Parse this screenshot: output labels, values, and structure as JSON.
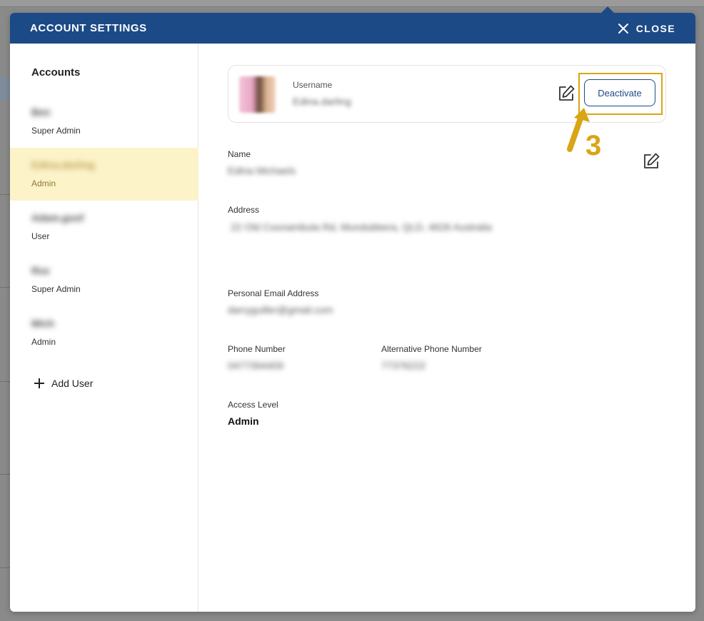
{
  "header": {
    "title": "ACCOUNT SETTINGS",
    "close_label": "CLOSE"
  },
  "sidebar": {
    "heading": "Accounts",
    "accounts": [
      {
        "name": "Ben",
        "role": "Super Admin",
        "selected": false
      },
      {
        "name": "Edina.darling",
        "role": "Admin",
        "selected": true
      },
      {
        "name": "Adam.goof",
        "role": "User",
        "selected": false
      },
      {
        "name": "Roz",
        "role": "Super Admin",
        "selected": false
      },
      {
        "name": "Mich",
        "role": "Admin",
        "selected": false
      }
    ],
    "add_user_label": "Add User"
  },
  "profile": {
    "username_label": "Username",
    "username_value": "Edina.darling",
    "deactivate_label": "Deactivate",
    "annotation_number": "3",
    "name_label": "Name",
    "name_value": "Edina Michaels",
    "address_label": "Address",
    "address_value": "22 Old Coonambula Rd, Mundubbera, QLD, 4626 Australia",
    "email_label": "Personal Email Address",
    "email_value": "darryguiller@gmail.com",
    "phone_label": "Phone Number",
    "phone_value": "0477394409",
    "alt_phone_label": "Alternative Phone Number",
    "alt_phone_value": "77376222",
    "access_label": "Access Level",
    "access_value": "Admin"
  },
  "colors": {
    "header_bg": "#1c4a87",
    "selected_row": "#fdf3c9",
    "annotation": "#d9a515"
  }
}
